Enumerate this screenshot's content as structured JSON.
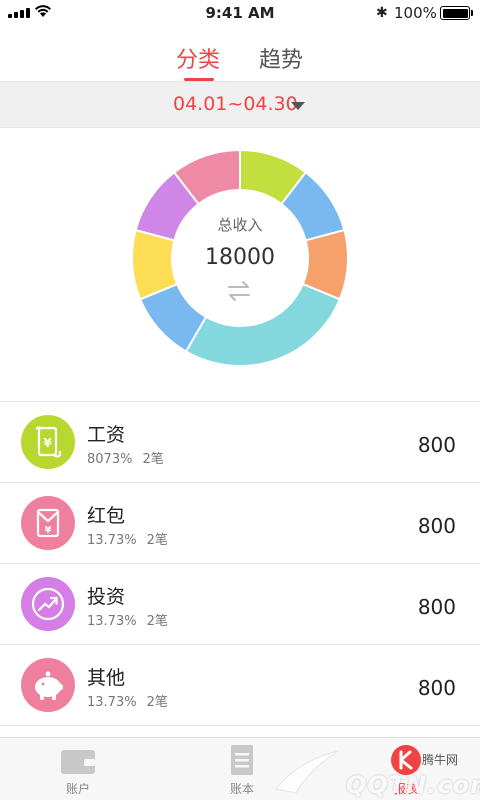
{
  "status_bar": {
    "time": "9:41 AM",
    "battery": "100%"
  },
  "tabs": {
    "active": "分类",
    "inactive": "趋势"
  },
  "date_range": "04.01~04.30",
  "summary": {
    "label": "总收入",
    "total": "18000"
  },
  "chart_data": {
    "type": "pie",
    "values": [
      10,
      10,
      10,
      26,
      10,
      10,
      10,
      10
    ],
    "colors": [
      "#c3de3f",
      "#7ab8f0",
      "#f6a06c",
      "#83d8de",
      "#7ab8f0",
      "#fddd55",
      "#d086e6",
      "#ef8aa6"
    ]
  },
  "items": [
    {
      "name": "工资",
      "percent": "8073%",
      "count": "2笔",
      "amount": "800",
      "color": "#b8d82f",
      "icon": "scroll-yen-icon"
    },
    {
      "name": "红包",
      "percent": "13.73%",
      "count": "2笔",
      "amount": "800",
      "color": "#ef7f9f",
      "icon": "red-envelope-icon"
    },
    {
      "name": "投资",
      "percent": "13.73%",
      "count": "2笔",
      "amount": "800",
      "color": "#d57ee6",
      "icon": "trend-up-icon"
    },
    {
      "name": "其他",
      "percent": "13.73%",
      "count": "2笔",
      "amount": "800",
      "color": "#ef7f9f",
      "icon": "piggy-bank-icon"
    }
  ],
  "nav": {
    "account": "账户",
    "book": "账本",
    "report": "报表"
  },
  "watermark": {
    "text": "QQTN.com",
    "brand": "腾牛网"
  }
}
